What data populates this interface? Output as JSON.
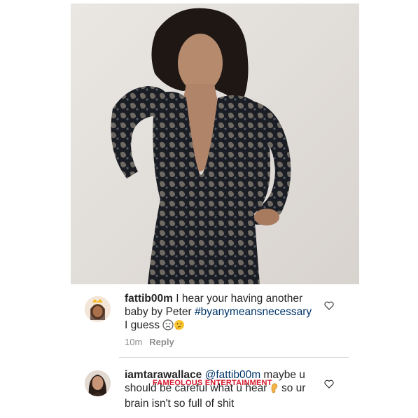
{
  "post_image": {
    "alt": "Woman in black sequined long-sleeve dress posing"
  },
  "comments": [
    {
      "username": "fattib00m",
      "text_part1": " I hear your having another",
      "text_part2": "baby by Peter ",
      "hashtag": "#byanymeansnecessary",
      "text_part3": "I guess ",
      "time": "10m",
      "reply_label": "Reply",
      "avatar_icon": "crowned-emoji-avatar",
      "emojis": [
        "worried-face-emoji",
        "thinking-face-emoji"
      ]
    },
    {
      "username": "iamtarawallace",
      "mention": "@fattib00m",
      "text_part1": " maybe u",
      "text_part2": "should be careful what u hear ",
      "text_part3": " so ur",
      "text_part4": "brain isn't so full of shit",
      "avatar_icon": "profile-photo-avatar",
      "emojis": [
        "ear-emoji"
      ]
    }
  ],
  "watermark": "FAMEOLOUS ENTERTAINMENT",
  "colors": {
    "text": "#262626",
    "link": "#003569",
    "meta": "#8e8e8e",
    "watermark": "#d6152a"
  }
}
